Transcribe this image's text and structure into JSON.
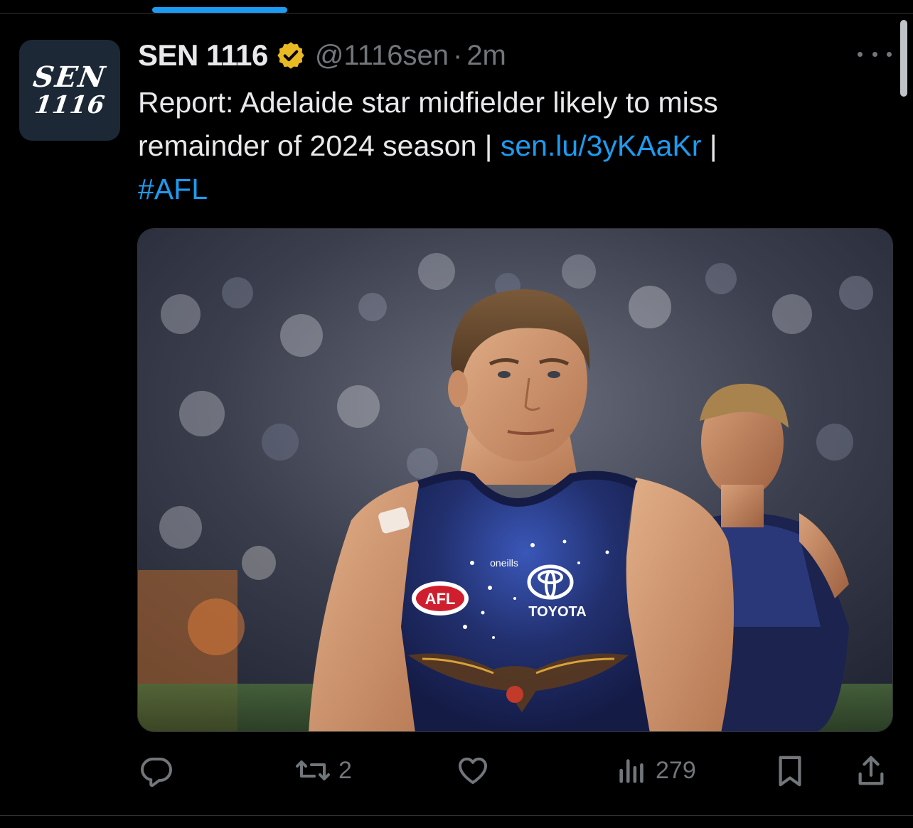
{
  "colors": {
    "background": "#000000",
    "text": "#e7e9ea",
    "secondary": "#71767b",
    "link": "#1d9bf0",
    "verified": "#e8b923",
    "tab_indicator": "#1d9bf0"
  },
  "avatar": {
    "line1": "SEN",
    "line2": "1116"
  },
  "tweet": {
    "display_name": "SEN 1116",
    "handle": "@1116sen",
    "separator": "·",
    "time": "2m",
    "text_part1": "Report: Adelaide star midfielder likely to miss remainder of 2024 season | ",
    "link": "sen.lu/3yKAaKr",
    "text_part2": " |",
    "hashtag": "#AFL"
  },
  "media": {
    "jersey_brand": "oneills",
    "jersey_sponsor": "TOYOTA",
    "jersey_league": "AFL"
  },
  "actions": {
    "reply_icon": "reply-icon",
    "retweet_icon": "retweet-icon",
    "retweet_count": "2",
    "like_icon": "heart-icon",
    "views_icon": "views-icon",
    "views_count": "279",
    "bookmark_icon": "bookmark-icon",
    "share_icon": "share-icon"
  }
}
